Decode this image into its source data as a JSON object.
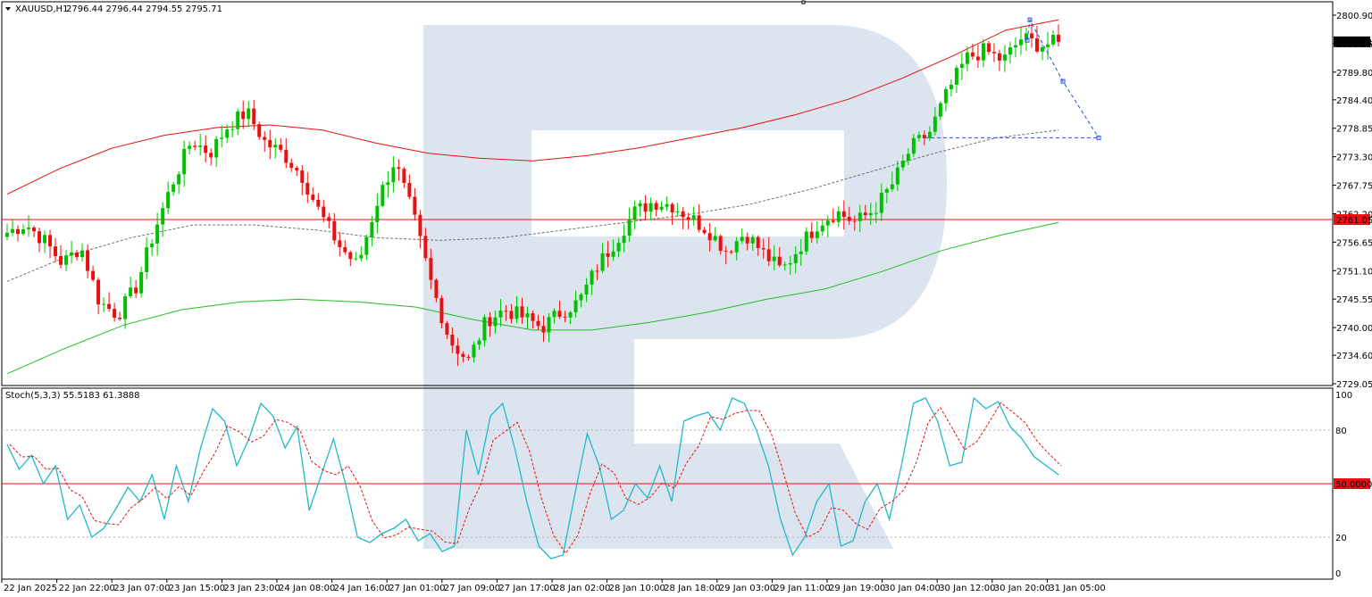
{
  "header": {
    "symbol_text": "XAUUSD,H1",
    "ohlc_text": "2796.44 2796.44 2794.55 2795.71",
    "stoch_text": "Stoch(5,3,3) 55.5183 61.3888"
  },
  "colors": {
    "bull": "#00c000",
    "bear": "#e81010",
    "ma_red": "#e81010",
    "ma_green": "#20c020",
    "ma_dash": "#707070",
    "stoch_main": "#20b8c8",
    "stoch_signal": "#e81010",
    "forecast": "#2050e0",
    "watermark": "#d6dfec"
  },
  "chart_data": [
    {
      "type": "candlestick",
      "symbol": "XAUUSD",
      "timeframe": "H1",
      "ylim": [
        2729.05,
        2800.9
      ],
      "y_ticks": [
        "2800.90",
        "2795.35",
        "2789.80",
        "2784.40",
        "2778.85",
        "2773.30",
        "2767.75",
        "2762.20",
        "2756.65",
        "2751.10",
        "2745.55",
        "2740.00",
        "2734.60",
        "2729.05"
      ],
      "x_ticks": [
        "22 Jan 2025",
        "22 Jan 22:00",
        "23 Jan 07:00",
        "23 Jan 15:00",
        "23 Jan 23:00",
        "24 Jan 08:00",
        "24 Jan 16:00",
        "27 Jan 01:00",
        "27 Jan 09:00",
        "27 Jan 17:00",
        "28 Jan 02:00",
        "28 Jan 10:00",
        "28 Jan 18:00",
        "29 Jan 03:00",
        "29 Jan 11:00",
        "29 Jan 19:00",
        "30 Jan 04:00",
        "30 Jan 12:00",
        "30 Jan 20:00",
        "31 Jan 05:00"
      ],
      "candles_count": 197,
      "current_price": "2795.71",
      "horizontal_level": "2761.05",
      "key_closes": [
        2758.5,
        2760.2,
        2757.0,
        2752.5,
        2755.8,
        2745.0,
        2742.5,
        2748.0,
        2759.0,
        2768.5,
        2776.5,
        2774.0,
        2779.5,
        2782.0,
        2776.0,
        2773.8,
        2769.5,
        2762.0,
        2756.0,
        2752.0,
        2764.0,
        2772.5,
        2762.0,
        2748.5,
        2737.5,
        2733.5,
        2741.5,
        2743.5,
        2742.0,
        2740.0,
        2743.0,
        2745.0,
        2752.0,
        2757.0,
        2762.5,
        2764.5,
        2764.0,
        2761.5,
        2759.0,
        2755.0,
        2758.5,
        2754.5,
        2751.0,
        2756.0,
        2760.5,
        2762.5,
        2760.5,
        2763.0,
        2768.0,
        2775.0,
        2778.0,
        2786.0,
        2792.5,
        2794.0,
        2792.0,
        2796.5,
        2795.0,
        2795.71
      ],
      "ma_red": [
        2766.0,
        2771.0,
        2775.0,
        2777.5,
        2779.0,
        2779.5,
        2778.5,
        2776.0,
        2774.0,
        2773.0,
        2772.5,
        2773.5,
        2775.0,
        2777.0,
        2779.0,
        2781.5,
        2784.5,
        2788.5,
        2793.0,
        2798.0,
        2800.0
      ],
      "ma_dash": [
        2749.0,
        2754.0,
        2757.5,
        2760.0,
        2760.0,
        2759.0,
        2757.5,
        2757.0,
        2757.5,
        2759.0,
        2760.5,
        2762.0,
        2764.0,
        2767.0,
        2770.5,
        2774.0,
        2777.0,
        2778.5
      ],
      "ma_green": [
        2731.0,
        2736.0,
        2740.5,
        2743.5,
        2745.0,
        2745.5,
        2745.0,
        2744.0,
        2741.5,
        2739.5,
        2739.5,
        2741.0,
        2743.0,
        2745.5,
        2747.5,
        2751.0,
        2755.0,
        2758.0,
        2760.5
      ],
      "forecast_path": [
        "2796",
        "2800",
        "2788",
        "2777",
        "2777"
      ]
    },
    {
      "type": "line",
      "indicator": "Stoch(5,3,3)",
      "ylim": [
        0,
        100
      ],
      "y_ticks": [
        "100",
        "80",
        "20",
        "0"
      ],
      "levels": [
        20,
        50,
        80
      ],
      "level_label": "50.0000",
      "main_value": 55.5183,
      "signal_value": 61.3888,
      "main_line": [
        72,
        58,
        66,
        50,
        60,
        30,
        38,
        20,
        25,
        36,
        48,
        40,
        55,
        30,
        60,
        40,
        70,
        92,
        85,
        60,
        75,
        95,
        88,
        70,
        82,
        35,
        55,
        75,
        50,
        20,
        17,
        22,
        25,
        30,
        18,
        22,
        12,
        15,
        80,
        55,
        88,
        95,
        70,
        40,
        15,
        8,
        10,
        45,
        78,
        60,
        30,
        35,
        50,
        42,
        60,
        40,
        85,
        88,
        90,
        80,
        98,
        95,
        80,
        60,
        30,
        10,
        20,
        40,
        50,
        15,
        18,
        40,
        50,
        30,
        60,
        95,
        98,
        85,
        60,
        62,
        98,
        92,
        96,
        82,
        75,
        65,
        60,
        55
      ]
    }
  ]
}
